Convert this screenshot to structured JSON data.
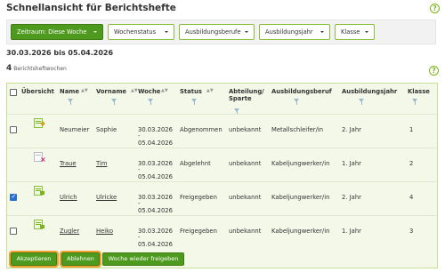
{
  "header": {
    "title": "Schnellansicht für Berichtshefte",
    "help": "?"
  },
  "filters": {
    "timeframe": "Zeitraum: Diese Woche",
    "week_status": "Wochenstatus",
    "occupation": "Ausbildungsberufe",
    "year": "Ausbildungsjahr",
    "class": "Klasse"
  },
  "date_range": "30.03.2026 bis 05.04.2026",
  "count": {
    "value": "4",
    "label": "Berichtsheftwochen"
  },
  "table": {
    "columns": {
      "overview": "Übersicht",
      "name": "Name",
      "first_name": "Vorname",
      "week": "Woche",
      "status": "Status",
      "department": "Abteilung/ Sparte",
      "occupation": "Ausbildungsberuf",
      "year": "Ausbildungsjahr",
      "class": "Klasse"
    },
    "rows": [
      {
        "checked": false,
        "icon": "edit",
        "name": "Neumeier",
        "first_name": "Sophie",
        "week_start": "30.03.2026",
        "week_dash": "-",
        "week_end": "05.04.2026",
        "status": "Abgenommen",
        "department": "unbekannt",
        "occupation": "Metallschleifer/in",
        "year": "2. Jahr",
        "class": "1"
      },
      {
        "checked": false,
        "icon": "rejected",
        "name": "Traue",
        "first_name": "Tim",
        "week_start": "30.03.2026",
        "week_dash": "-",
        "week_end": "05.04.2026",
        "status": "Abgelehnt",
        "department": "unbekannt",
        "occupation": "Kabeljungwerker/in",
        "year": "1. Jahr",
        "class": "2"
      },
      {
        "checked": true,
        "icon": "approved",
        "name": "Ulrich",
        "first_name": "Ulricke",
        "week_start": "30.03.2026",
        "week_dash": "-",
        "week_end": "05.04.2026",
        "status": "Freigegeben",
        "department": "unbekannt",
        "occupation": "Kabeljungwerker/in",
        "year": "2. Jahr",
        "class": "4"
      },
      {
        "checked": false,
        "icon": "approved",
        "name": "Zugler",
        "first_name": "Heiko",
        "week_start": "30.03.2026",
        "week_dash": "-",
        "week_end": "05.04.2026",
        "status": "Freigegeben",
        "department": "unbekannt",
        "occupation": "Kabeljungwerker/in",
        "year": "1. Jahr",
        "class": "3"
      }
    ]
  },
  "actions": {
    "accept": "Akzeptieren",
    "reject": "Ablehnen",
    "release": "Woche wieder freigeben"
  },
  "colors": {
    "primary_green": "#4e9a1e",
    "accent_green": "#7ab51d",
    "focus_orange": "#f0a030",
    "checkbox_blue": "#2a6fd1"
  }
}
